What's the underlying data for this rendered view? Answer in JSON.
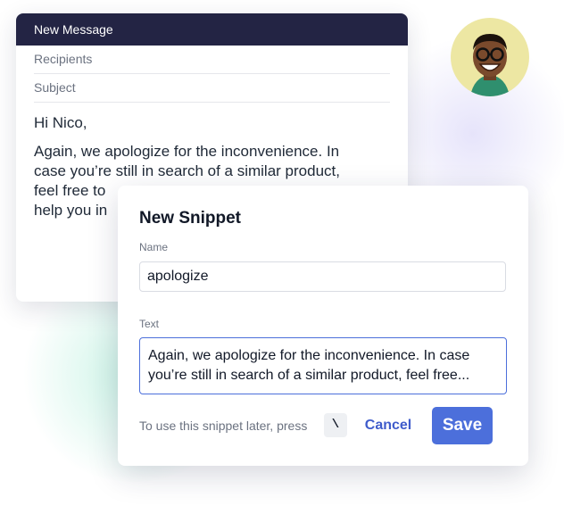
{
  "compose": {
    "header_title": "New Message",
    "recipients_placeholder": "Recipients",
    "subject_placeholder": "Subject",
    "greeting": "Hi Nico,",
    "body_lines": [
      "Again, we apologize for the inconvenience. In",
      "case you’re still in search of a similar product,",
      "feel free to",
      "help you in"
    ]
  },
  "avatar": {
    "icon": "user-photo-icon",
    "background": "#ede7a3"
  },
  "snippet": {
    "title": "New Snippet",
    "name_label": "Name",
    "name_value": "apologize",
    "text_label": "Text",
    "text_lines": [
      "Again, we apologize for the inconvenience. In case",
      "you’re still in search of a similar product, feel free..."
    ],
    "hint": "To use this snippet later, press",
    "shortcut_key": "\\",
    "cancel_label": "Cancel",
    "save_label": "Save"
  },
  "colors": {
    "header_bg": "#232444",
    "accent": "#4c6fdb",
    "link": "#3f5ccb"
  }
}
